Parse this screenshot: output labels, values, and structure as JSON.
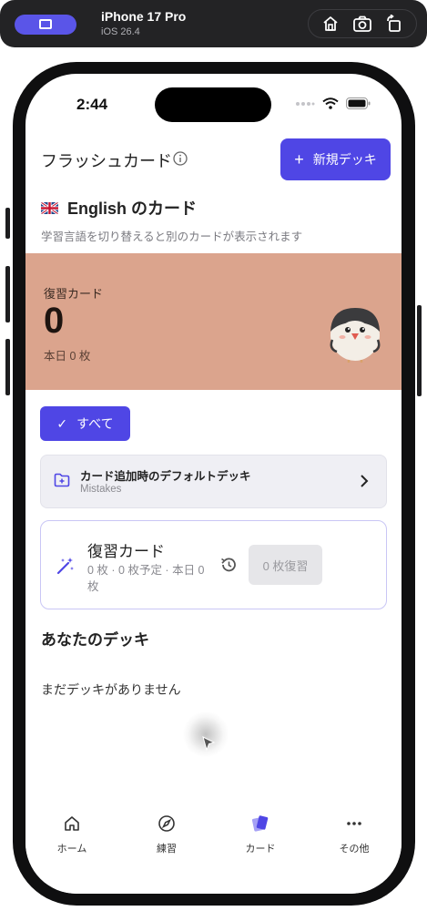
{
  "simulator": {
    "device_name": "iPhone 17 Pro",
    "os_version": "iOS 26.4",
    "icons": [
      "home-icon",
      "screenshot-icon",
      "rotate-icon"
    ]
  },
  "status_bar": {
    "time": "2:44"
  },
  "header": {
    "title": "フラッシュカード",
    "new_deck_label": "新規デッキ",
    "new_deck_plus": "+"
  },
  "language": {
    "flag": "uk-flag-icon",
    "title": "English のカード",
    "hint": "学習言語を切り替えると別のカードが表示されます"
  },
  "review_banner": {
    "label": "復習カード",
    "count": "0",
    "today": "本日 0 枚",
    "color": "#dba48d"
  },
  "filter": {
    "label": "すべて",
    "check": "✓"
  },
  "default_deck": {
    "title": "カード追加時のデフォルトデッキ",
    "value": "Mistakes",
    "chevron": "›"
  },
  "review_card": {
    "title": "復習カード",
    "meta": "0 枚 · 0 枚予定 · 本日 0 枚",
    "button_label": "0 枚復習"
  },
  "decks": {
    "section_title": "あなたのデッキ",
    "empty_message": "まだデッキがありません"
  },
  "tab_bar": {
    "tabs": [
      {
        "label": "ホーム",
        "icon": "home-icon"
      },
      {
        "label": "練習",
        "icon": "compass-icon"
      },
      {
        "label": "カード",
        "icon": "cards-icon",
        "active": true
      },
      {
        "label": "その他",
        "icon": "more-icon"
      }
    ]
  },
  "colors": {
    "accent": "#4f46e5",
    "banner": "#dba48d"
  }
}
